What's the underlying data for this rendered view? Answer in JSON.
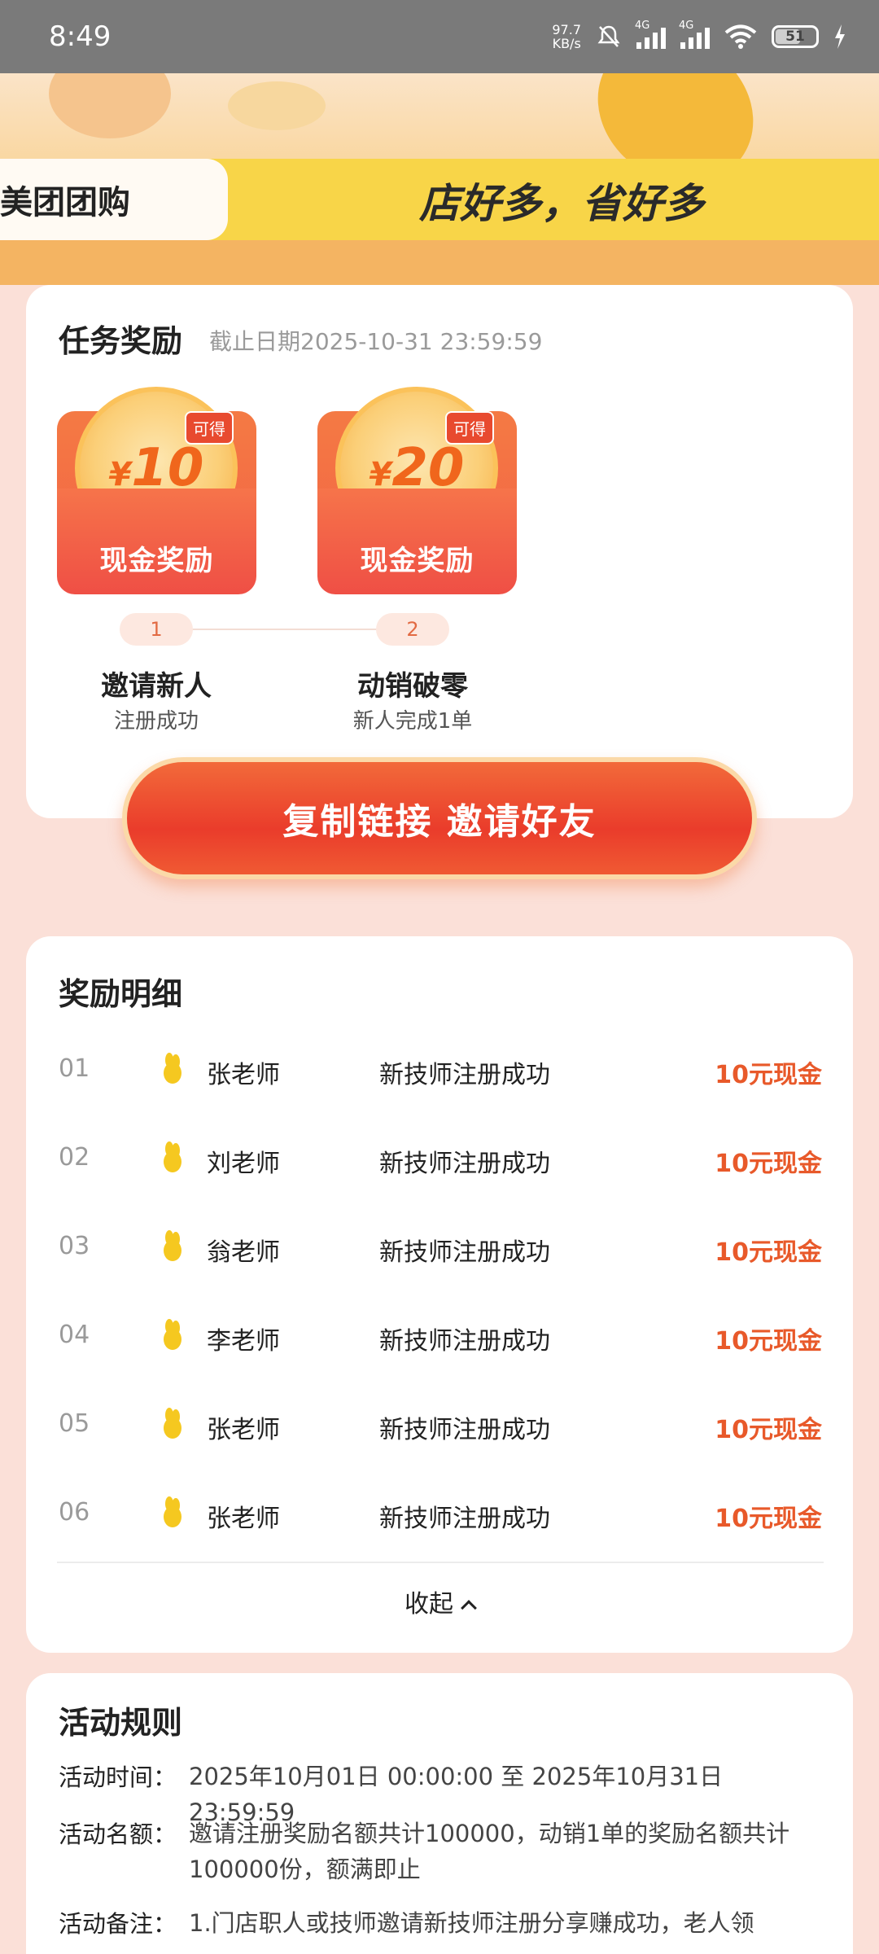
{
  "status_bar": {
    "time": "8:49",
    "speed_value": "97.7",
    "speed_unit": "KB/s",
    "signal1_label": "4G",
    "signal2_label": "4G",
    "battery": "51"
  },
  "banner": {
    "brand_label": "美团团购",
    "slogan": "店好多，省好多"
  },
  "task": {
    "title": "任务奖励",
    "deadline": "截止日期2025-10-31 23:59:59",
    "rewards": [
      {
        "amount": "10",
        "currency": "¥",
        "badge": "可得",
        "label": "现金奖励"
      },
      {
        "amount": "20",
        "currency": "¥",
        "badge": "可得",
        "label": "现金奖励"
      }
    ],
    "steps": [
      {
        "num": "1",
        "title": "邀请新人",
        "sub": "注册成功"
      },
      {
        "num": "2",
        "title": "动销破零",
        "sub": "新人完成1单"
      }
    ],
    "cta_label": "复制链接 邀请好友"
  },
  "detail": {
    "title": "奖励明细",
    "rows": [
      {
        "idx": "01",
        "name": "张老师",
        "desc": "新技师注册成功",
        "amount": "10元现金"
      },
      {
        "idx": "02",
        "name": "刘老师",
        "desc": "新技师注册成功",
        "amount": "10元现金"
      },
      {
        "idx": "03",
        "name": "翁老师",
        "desc": "新技师注册成功",
        "amount": "10元现金"
      },
      {
        "idx": "04",
        "name": "李老师",
        "desc": "新技师注册成功",
        "amount": "10元现金"
      },
      {
        "idx": "05",
        "name": "张老师",
        "desc": "新技师注册成功",
        "amount": "10元现金"
      },
      {
        "idx": "06",
        "name": "张老师",
        "desc": "新技师注册成功",
        "amount": "10元现金"
      }
    ],
    "collapse_label": "收起"
  },
  "rules": {
    "title": "活动规则",
    "items": [
      {
        "key": "活动时间：",
        "value": "2025年10月01日 00:00:00 至 2025年10月31日 23:59:59"
      },
      {
        "key": "活动名额：",
        "value": "邀请注册奖励名额共计100000，动销1单的奖励名额共计100000份，额满即止"
      },
      {
        "key": "活动备注：",
        "value": "1.门店职人或技师邀请新技师注册分享赚成功，老人领"
      }
    ]
  },
  "colors": {
    "accent": "#e8592a",
    "cta": "#ea3c2b",
    "page_bg": "#fbe0d8"
  }
}
